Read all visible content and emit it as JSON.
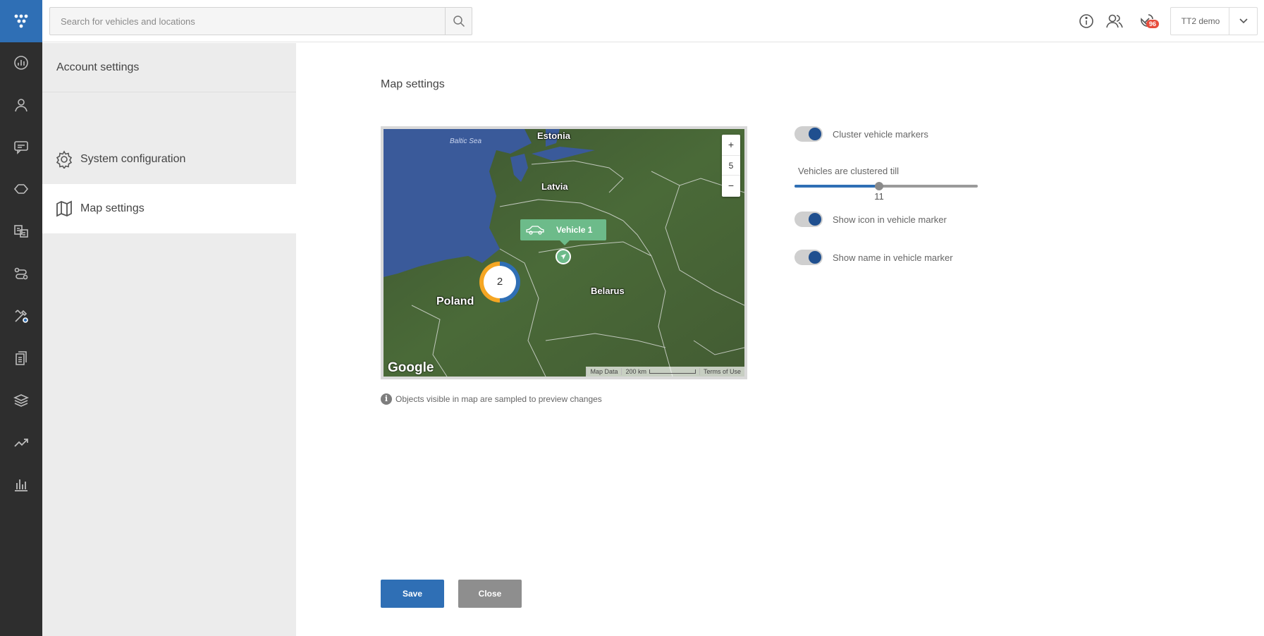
{
  "header": {
    "search_placeholder": "Search for vehicles and locations",
    "notifications_count": "96",
    "account_name": "TT2 demo"
  },
  "rail": {
    "icons": [
      "stats-icon",
      "person-icon",
      "messages-icon",
      "routes-icon",
      "dictionary-icon",
      "tasks-icon",
      "tools-icon",
      "documents-icon",
      "layers-icon",
      "trending-icon",
      "bar-chart-icon"
    ]
  },
  "sidebar": {
    "account_settings": "Account settings",
    "items": [
      {
        "label": "System configuration",
        "icon": "gear-icon"
      },
      {
        "label": "Map settings",
        "icon": "map-icon"
      }
    ]
  },
  "main": {
    "title": "Map settings",
    "map": {
      "labels": {
        "sea": "Baltic Sea",
        "estonia": "Estonia",
        "latvia": "Latvia",
        "poland": "Poland",
        "belarus": "Belarus"
      },
      "zoom_in": "+",
      "zoom_level": "5",
      "zoom_out": "−",
      "vehicle_name": "Vehicle 1",
      "cluster_count": "2",
      "google": "Google",
      "attribution": {
        "map_data": "Map Data",
        "scale": "200 km",
        "terms": "Terms of Use"
      }
    },
    "info_text": "Objects visible in map are sampled to preview changes",
    "options": {
      "cluster_markers": "Cluster vehicle markers",
      "clustered_till_label": "Vehicles are clustered till",
      "clustered_till_value": "11",
      "clustered_till_fraction": 0.46,
      "show_icon": "Show icon in vehicle marker",
      "show_name": "Show name in vehicle marker"
    },
    "buttons": {
      "save": "Save",
      "close": "Close"
    }
  },
  "colors": {
    "accent": "#2f6fb5",
    "rail": "#2e2e2e",
    "vehicle": "#6dbb8a",
    "cluster_orange": "#f5a623"
  }
}
